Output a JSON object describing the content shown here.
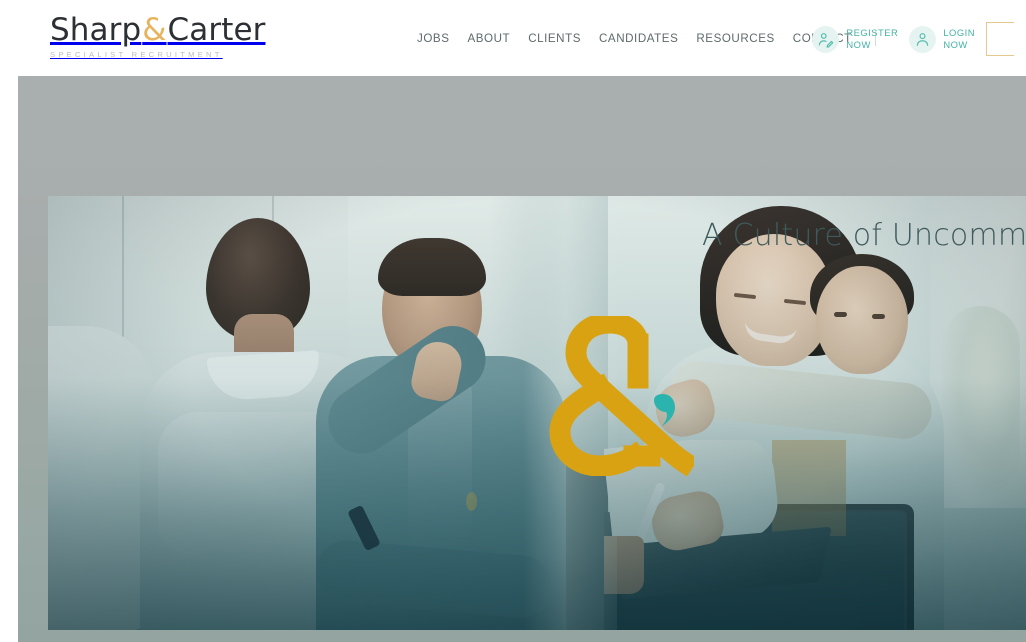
{
  "brand": {
    "name_part1": "Sharp",
    "ampersand": "&",
    "name_part2": "Carter",
    "tagline": "SPECIALIST RECRUITMENT"
  },
  "nav": {
    "items": [
      {
        "label": "JOBS"
      },
      {
        "label": "ABOUT"
      },
      {
        "label": "CLIENTS"
      },
      {
        "label": "CANDIDATES"
      },
      {
        "label": "RESOURCES"
      },
      {
        "label": "CONTACT"
      }
    ]
  },
  "account": {
    "register": {
      "line1": "REGISTER",
      "line2": "NOW",
      "icon": "user-edit-icon"
    },
    "login": {
      "line1": "LOGIN",
      "line2": "NOW",
      "icon": "user-icon"
    }
  },
  "search": {
    "icon": "search-icon",
    "placeholder": ""
  },
  "hero": {
    "title": "A Culture of Uncommon C",
    "logo_mark": "ampersand-mark",
    "photo_alt": "office collage: colleagues talking, woman with child at laptop, hand writing on tablet"
  },
  "colors": {
    "brand_amber": "#e8b35f",
    "accent_teal": "#43b3a5",
    "nav_text": "#5e6a6d",
    "wordmark": "#2c2f33",
    "tagline": "#b9bcbe",
    "hero_title": "#3f5a5c",
    "amp_mark_gold": "#d9a212",
    "amp_mark_teal": "#2bb3ae",
    "search_border": "#e3c98f",
    "hero_bg_top": "#a9aeae",
    "hero_bg_bottom": "#93a4a1"
  }
}
